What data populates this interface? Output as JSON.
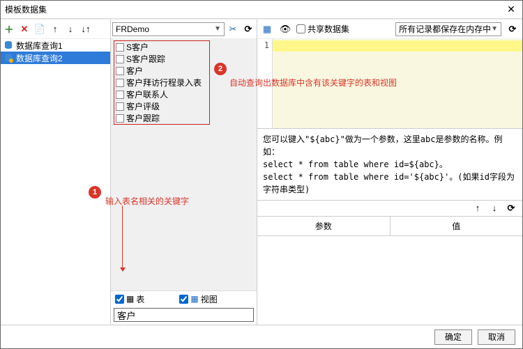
{
  "window": {
    "title": "模板数据集"
  },
  "left": {
    "toolbar": [
      "add",
      "remove",
      "copy",
      "up",
      "down",
      "sort"
    ],
    "datasets": [
      {
        "name": "数据库查询1",
        "selected": false
      },
      {
        "name": "数据库查询2",
        "selected": true
      }
    ]
  },
  "center": {
    "db_selected": "FRDemo",
    "tables": [
      "S客户",
      "S客户跟踪",
      "客户",
      "客户拜访行程录入表",
      "客户联系人",
      "客户评级",
      "客户跟踪"
    ],
    "filter_table_checked": true,
    "filter_table_label": "表",
    "filter_view_checked": true,
    "filter_view_label": "视图",
    "filter_input_value": "客户",
    "annotations": {
      "a1": {
        "num": "1",
        "text": "输入表名相关的关键字"
      },
      "a2": {
        "num": "2",
        "text": "自动查询出数据库中含有该关键字的表和视图"
      }
    }
  },
  "right": {
    "share_label": "共享数据集",
    "share_checked": false,
    "memory_selected": "所有记录都保存在内存中",
    "editor_line": "1",
    "hint1": "您可以键入\"${abc}\"做为一个参数，这里abc是参数的名称。例如：",
    "hint2": "select * from table where id=${abc}。",
    "hint3": "select * from table where id='${abc}'。(如果id字段为字符串类型)",
    "param_header_name": "参数",
    "param_header_value": "值"
  },
  "footer": {
    "ok": "确定",
    "cancel": "取消"
  }
}
